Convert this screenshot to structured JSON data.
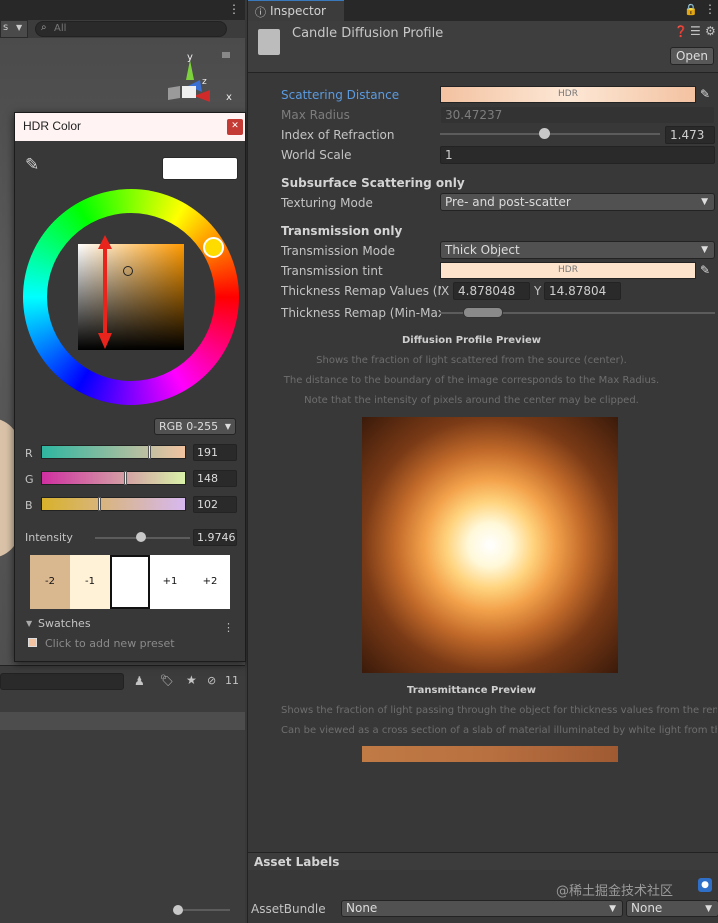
{
  "scene_panel": {
    "search_placeholder": "All",
    "gizmo_axes": [
      "y",
      "x",
      "z"
    ],
    "hidden_count": "11"
  },
  "hdr_color": {
    "title": "HDR Color",
    "preview_color": "#ffffff",
    "mode": "RGB 0-255",
    "channels": [
      {
        "label": "R",
        "value": "191",
        "fraction": 0.75
      },
      {
        "label": "G",
        "value": "148",
        "fraction": 0.58
      },
      {
        "label": "B",
        "value": "102",
        "fraction": 0.4
      }
    ],
    "intensity_label": "Intensity",
    "intensity_value": "1.9746",
    "intensity_fraction": 0.45,
    "stops": [
      "-2",
      "-1",
      "",
      "+1",
      "+2"
    ],
    "swatches_label": "Swatches",
    "add_preset_label": "Click to add new preset"
  },
  "inspector": {
    "tab": "Inspector",
    "title": "Candle Diffusion Profile",
    "open_label": "Open",
    "scattering_distance_label": "Scattering Distance",
    "hdr_text": "HDR",
    "max_radius_label": "Max Radius",
    "max_radius_value": "30.47237",
    "ior_label": "Index of Refraction",
    "ior_value": "1.473",
    "ior_fraction": 0.47,
    "world_scale_label": "World Scale",
    "world_scale_value": "1",
    "sss_section": "Subsurface Scattering only",
    "texturing_mode_label": "Texturing Mode",
    "texturing_mode_value": "Pre- and post-scatter",
    "transmission_section": "Transmission only",
    "transmission_mode_label": "Transmission Mode",
    "transmission_mode_value": "Thick Object",
    "transmission_tint_label": "Transmission tint",
    "thickness_remap_values_label": "Thickness Remap Values (M",
    "thickness_x_label": "X",
    "thickness_x_value": "4.878048",
    "thickness_y_label": "Y",
    "thickness_y_value": "14.87804",
    "thickness_remap_label": "Thickness Remap (Min-Max",
    "diffusion_preview_title": "Diffusion Profile Preview",
    "diffusion_captions": [
      "Shows the fraction of light scattered from the source (center).",
      "The distance to the boundary of the image corresponds to the Max Radius.",
      "Note that the intensity of pixels around the center may be clipped."
    ],
    "transmittance_preview_title": "Transmittance Preview",
    "transmittance_captions": [
      "Shows the fraction of light passing through the object for thickness values from the remap",
      "Can be viewed as a cross section of a slab of material illuminated by white light from the lef"
    ],
    "asset_labels_title": "Asset Labels",
    "asset_bundle_label": "AssetBundle",
    "asset_bundle_value": "None",
    "asset_variant_value": "None",
    "watermark": "@稀土掘金技术社区"
  },
  "colors": {
    "scattering_bar_start": "#f3c2a1",
    "scattering_bar_end": "#fde8d6",
    "tint_bar": "#fde3cc",
    "accent_blue": "#5b9be1"
  }
}
